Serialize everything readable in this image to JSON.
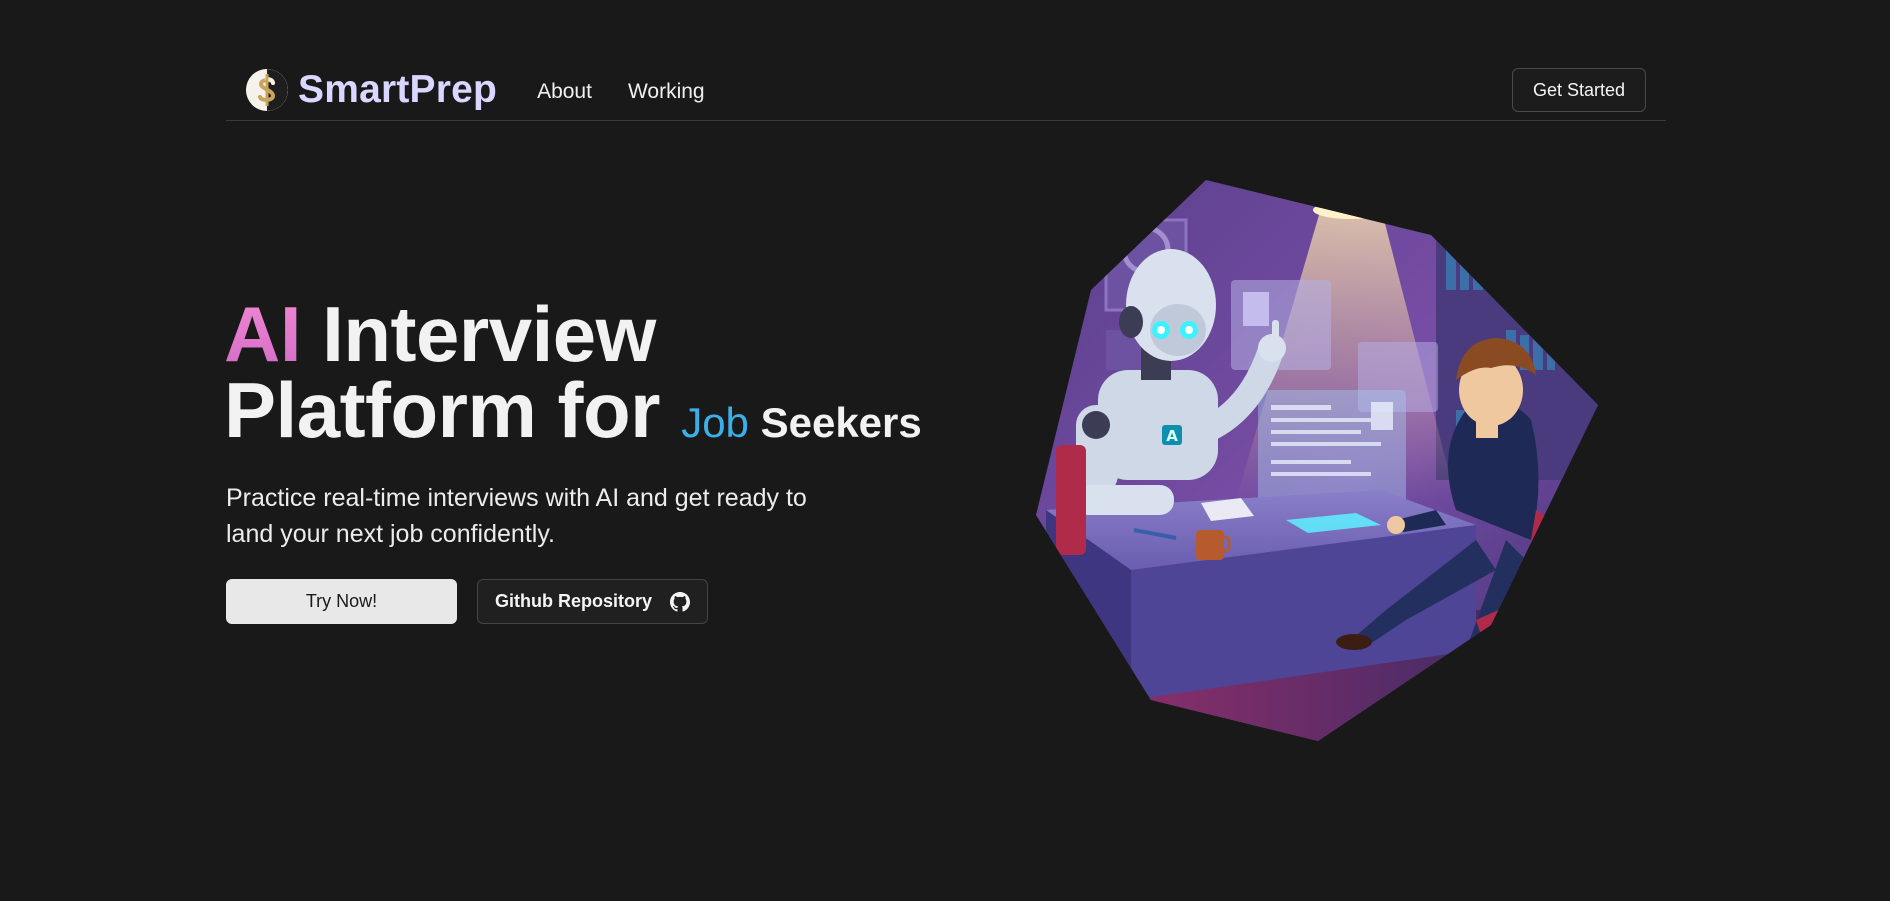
{
  "brand": {
    "name": "SmartPrep"
  },
  "nav": {
    "links": [
      {
        "label": "About"
      },
      {
        "label": "Working"
      }
    ],
    "cta": "Get Started"
  },
  "hero": {
    "title_highlight": "AI",
    "title_rest": " Interview",
    "title_line2": "Platform for ",
    "title_job": "Job",
    "title_seekers": " Seekers",
    "subtitle": "Practice real-time interviews with AI and get ready to land your next job confidently.",
    "primary_button": "Try Now!",
    "secondary_button": "Github Repository"
  },
  "illustration": {
    "badge_letter": "A"
  },
  "colors": {
    "background": "#191919",
    "brand_text": "#d9d6ff",
    "ai_gradient_start": "#f28ad6",
    "ai_gradient_end": "#d26ac4",
    "job_accent": "#3bb0e8",
    "primary_button_bg": "#e8e8e8"
  },
  "icons": {
    "logo": "dollar-coin-icon",
    "github": "github-icon"
  }
}
